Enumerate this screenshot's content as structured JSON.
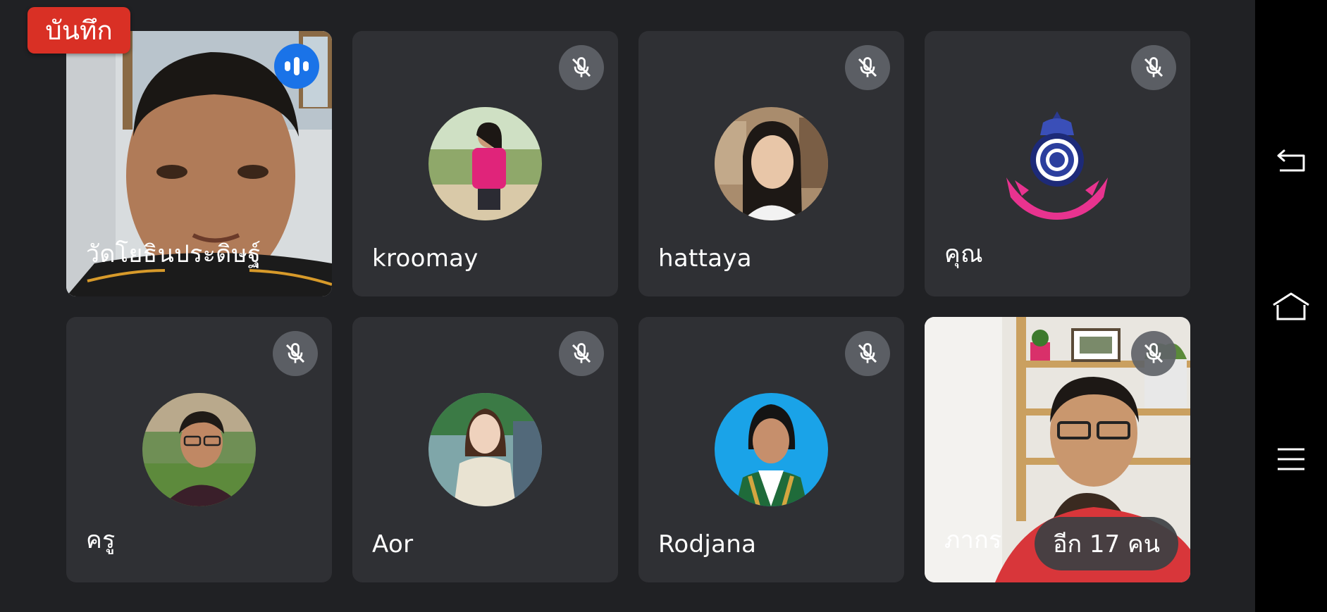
{
  "recording": {
    "label": "บันทึก"
  },
  "participants": [
    {
      "name": "วัดโยธินประดิษฐ์",
      "status": "speaking"
    },
    {
      "name": "kroomay",
      "status": "muted"
    },
    {
      "name": "hattaya",
      "status": "muted"
    },
    {
      "name": "คุณ",
      "status": "muted"
    },
    {
      "name": "ครู",
      "status": "muted"
    },
    {
      "name": "Aor",
      "status": "muted"
    },
    {
      "name": "Rodjana",
      "status": "muted"
    },
    {
      "name": "ภากร",
      "status": "muted"
    }
  ],
  "more_participants": {
    "label": "อีก 17 คน"
  },
  "system_nav": {
    "back_icon": "back-icon",
    "home_icon": "home-icon",
    "recents_icon": "menu-icon"
  },
  "colors": {
    "background": "#202124",
    "tile": "#2f3034",
    "speaking": "#1a73e8",
    "recording": "#d93025",
    "navbar": "#000000"
  }
}
